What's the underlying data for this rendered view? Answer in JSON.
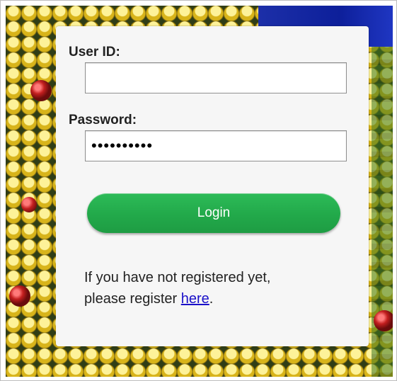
{
  "form": {
    "user_id_label": "User ID:",
    "user_id_value": "",
    "password_label": "Password:",
    "password_value": "••••••••••",
    "login_button": "Login",
    "register_prefix_line1": "If you have not registered yet,",
    "register_prefix_line2": "please register ",
    "register_link": "here",
    "register_suffix": "."
  },
  "colors": {
    "button_green": "#22a94a",
    "link_blue": "#1a10c9",
    "panel_bg": "#f6f6f6"
  }
}
